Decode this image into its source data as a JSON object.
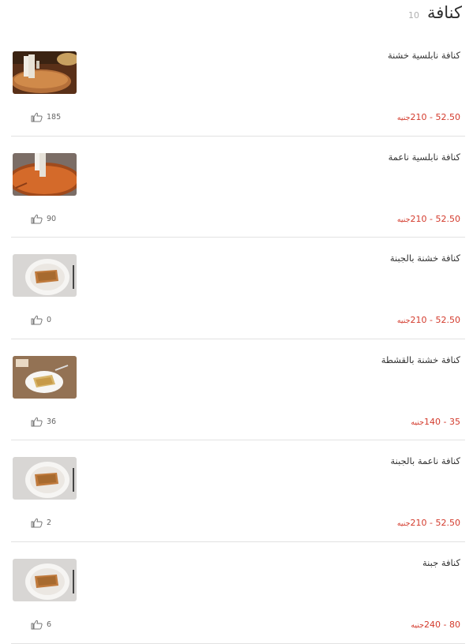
{
  "header": {
    "title": "كنافة",
    "count": "10"
  },
  "items": [
    {
      "name": "كنافة نابلسية خشنة",
      "price": "52.50 - 210",
      "unit": "جنيه",
      "likes": "185",
      "image": "kunafa-cheese-pull"
    },
    {
      "name": "كنافة نابلسية ناعمة",
      "price": "52.50 - 210",
      "unit": "جنيه",
      "likes": "90",
      "image": "kunafa-tray-cut"
    },
    {
      "name": "كنافة خشنة بالجبنة",
      "price": "52.50 - 210",
      "unit": "جنيه",
      "likes": "0",
      "image": "kunafa-plate"
    },
    {
      "name": "كنافة خشنة بالقشطة",
      "price": "35 - 140",
      "unit": "جنيه",
      "likes": "36",
      "image": "kunafa-plate-wood"
    },
    {
      "name": "كنافة ناعمة بالجبنة",
      "price": "52.50 - 210",
      "unit": "جنيه",
      "likes": "2",
      "image": "kunafa-plate"
    },
    {
      "name": "كنافة جبنة",
      "price": "80 - 240",
      "unit": "جنيه",
      "likes": "6",
      "image": "kunafa-plate"
    }
  ],
  "colors": {
    "price": "#d33a2c",
    "divider": "#e2e2e2"
  }
}
